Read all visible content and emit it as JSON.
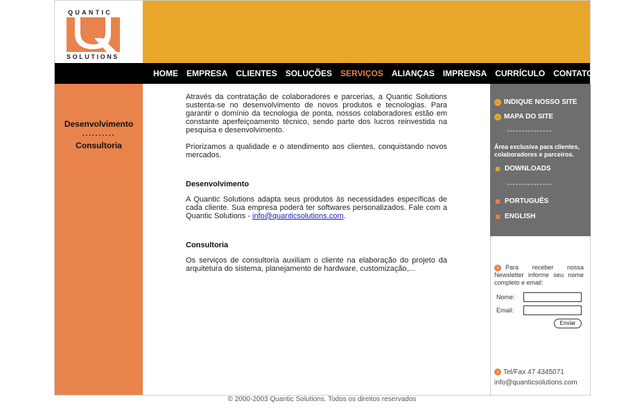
{
  "logo": {
    "top_text": "QUANTIC",
    "bottom_text": "SOLUTIONS"
  },
  "nav": [
    {
      "label": "HOME",
      "active": false
    },
    {
      "label": "EMPRESA",
      "active": false
    },
    {
      "label": "CLIENTES",
      "active": false
    },
    {
      "label": "SOLUÇÕES",
      "active": false
    },
    {
      "label": "SERVIÇOS",
      "active": true
    },
    {
      "label": "ALIANÇAS",
      "active": false
    },
    {
      "label": "IMPRENSA",
      "active": false
    },
    {
      "label": "CURRÍCULO",
      "active": false
    },
    {
      "label": "CONTATO",
      "active": false
    }
  ],
  "left_menu": {
    "item1": "Desenvolvimento",
    "separator": "..........",
    "item2": "Consultoria"
  },
  "content": {
    "intro1": "Através da contratação de colaboradores e parcerias, a Quantic Solutions sustenta-se no desenvolvimento de novos produtos e tecnologias. Para garantir o domínio da tecnologia de ponta, nossos colaboradores estão em constante aperfeiçoamento técnico, sendo parte dos lucros reinvestida na pesquisa e desenvolvimento.",
    "intro2": "Priorizamos a qualidade e o atendimento aos clientes, conquistando novos mercados.",
    "dev_title": "Desenvolvimento",
    "dev_text": "A Quantic Solutions adapta seus produtos às necessidades específicas de cada cliente. Sua empresa poderá ter softwares personalizados. Fale com a Quantic Solutions - ",
    "dev_email": "info@quanticsolutions.com",
    "dev_end": ".",
    "cons_title": "Consultoria",
    "cons_text": "Os serviços de consultoria auxiliam o cliente na elaboração do projeto da arquitetura do sistema, planejamento de hardware, customização,..."
  },
  "right": {
    "indique": "INDIQUE NOSSO SITE",
    "mapa": "MAPA DO SITE",
    "dash": "---------------",
    "area": "Área exclusiva para clientes, colaboradores e parceiros.",
    "downloads": "DOWNLOADS",
    "portugues": "PORTUGUÊS",
    "english": "ENGLISH"
  },
  "newsletter": {
    "text": "Para receber nossa Newsletter informe seu nome completo e email:",
    "name_label": "Nome:",
    "email_label": "Email:",
    "send": "Enviar"
  },
  "contact": {
    "phone": "Tel/Fax 47 4345071",
    "email": "info@quanticsolutions.com"
  },
  "footer": "© 2000-2003 Quantic Solutions. Todos os direitos reservados",
  "colors": {
    "banner": "#e8a62a",
    "accent_orange": "#e8834b",
    "right_panel": "#6e6e6e",
    "nav_bg": "#000000"
  }
}
